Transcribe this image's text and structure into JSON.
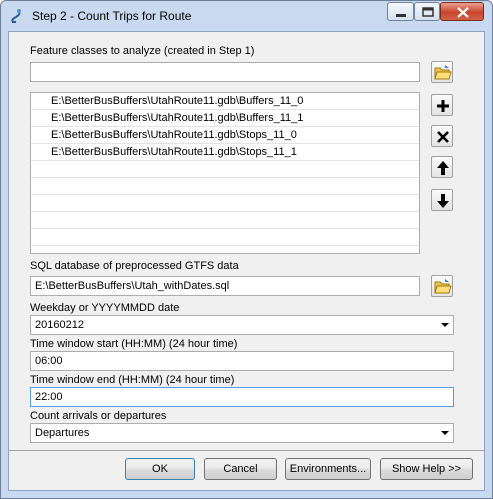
{
  "window": {
    "title": "Step 2 - Count Trips for Route"
  },
  "form": {
    "feature_classes_label": "Feature classes to analyze (created in Step 1)",
    "feature_classes_input": "",
    "feature_list": [
      "E:\\BetterBusBuffers\\UtahRoute11.gdb\\Buffers_11_0",
      "E:\\BetterBusBuffers\\UtahRoute11.gdb\\Buffers_11_1",
      "E:\\BetterBusBuffers\\UtahRoute11.gdb\\Stops_11_0",
      "E:\\BetterBusBuffers\\UtahRoute11.gdb\\Stops_11_1"
    ],
    "sql_label": "SQL database of preprocessed GTFS data",
    "sql_value": "E:\\BetterBusBuffers\\Utah_withDates.sql",
    "weekday_label": "Weekday or YYYYMMDD date",
    "weekday_value": "20160212",
    "start_label": "Time window start (HH:MM) (24 hour time)",
    "start_value": "06:00",
    "end_label": "Time window end (HH:MM) (24 hour time)",
    "end_value": "22:00",
    "count_label": "Count arrivals or departures",
    "count_value": "Departures"
  },
  "buttons": {
    "ok": "OK",
    "cancel": "Cancel",
    "environments": "Environments...",
    "show_help": "Show Help >>"
  },
  "icons": {
    "title": "script-tool-icon",
    "browse": "open-folder-icon",
    "add": "plus-icon",
    "remove": "x-icon",
    "up": "arrow-up-icon",
    "down": "arrow-down-icon"
  }
}
